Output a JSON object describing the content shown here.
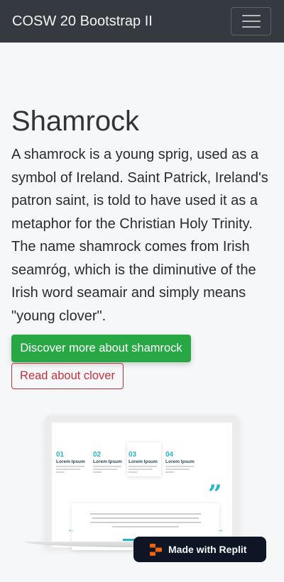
{
  "navbar": {
    "brand": "COSW 20 Bootstrap II",
    "toggler_icon": "hamburger-menu-icon"
  },
  "main": {
    "title": "Shamrock",
    "body": "A shamrock is a young sprig, used as a symbol of Ireland. Saint Patrick, Ireland's patron saint, is told to have used it as a metaphor for the Christian Holy Trinity. The name shamrock comes from Irish seamróg, which is the diminutive of the Irish word seamair and simply means \"young clover\".",
    "primary_button": "Discover more about shamrock",
    "secondary_button": "Read about clover"
  },
  "mockup": {
    "steps": [
      {
        "number": "01",
        "title": "Lorem Ipsum"
      },
      {
        "number": "02",
        "title": "Lorem Ipsum"
      },
      {
        "number": "03",
        "title": "Lorem Ipsum"
      },
      {
        "number": "04",
        "title": "Lorem Ipsum"
      }
    ],
    "quote_mark": "”",
    "arrow_left": "←",
    "arrow_right": "→"
  },
  "badge": {
    "label": "Made with Replit",
    "icon": "replit-logo-icon"
  },
  "colors": {
    "navbar_bg": "#343a40",
    "primary": "#28a745",
    "danger": "#c6303e",
    "accent": "#27b4c8",
    "badge_bg": "#0e1525",
    "replit_orange": "#f26207"
  }
}
